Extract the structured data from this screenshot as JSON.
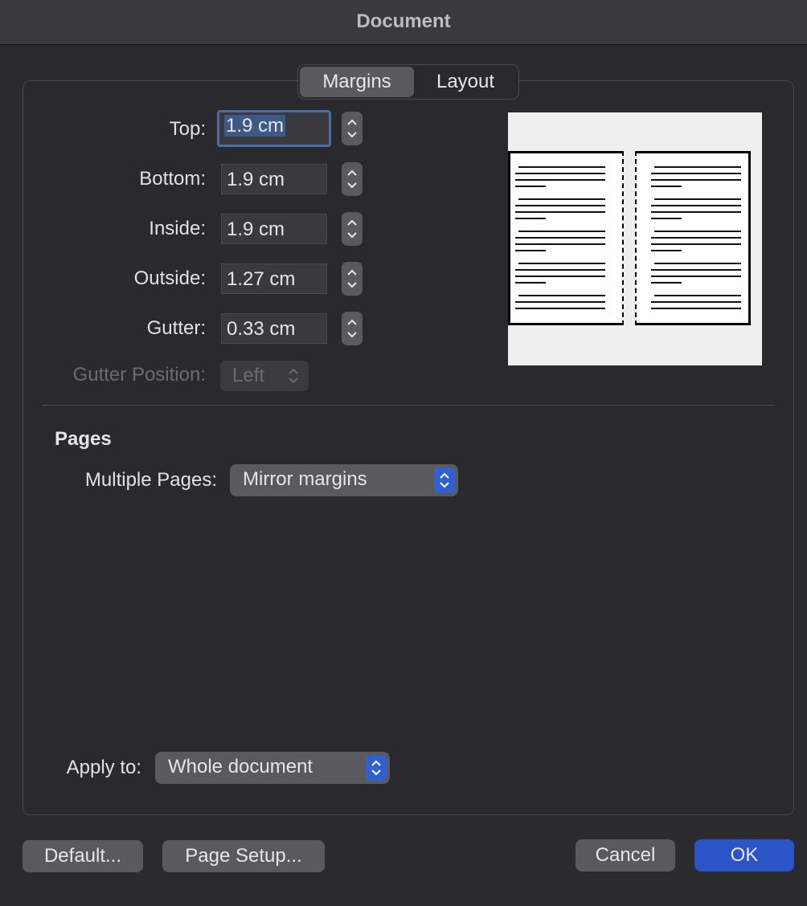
{
  "window": {
    "title": "Document"
  },
  "tabs": [
    {
      "label": "Margins",
      "active": true
    },
    {
      "label": "Layout",
      "active": false
    }
  ],
  "margins": {
    "top": {
      "label": "Top:",
      "value": "1.9 cm"
    },
    "bottom": {
      "label": "Bottom:",
      "value": "1.9 cm"
    },
    "inside": {
      "label": "Inside:",
      "value": "1.9 cm"
    },
    "outside": {
      "label": "Outside:",
      "value": "1.27 cm"
    },
    "gutter": {
      "label": "Gutter:",
      "value": "0.33 cm"
    },
    "gutter_position": {
      "label": "Gutter Position:",
      "value": "Left",
      "enabled": false
    }
  },
  "pages": {
    "section_title": "Pages",
    "multiple_pages": {
      "label": "Multiple Pages:",
      "value": "Mirror margins"
    }
  },
  "apply_to": {
    "label": "Apply to:",
    "value": "Whole document"
  },
  "buttons": {
    "default": "Default...",
    "page_setup": "Page Setup...",
    "cancel": "Cancel",
    "ok": "OK"
  },
  "colors": {
    "accent": "#2b55c6",
    "focus_ring": "#4a6ea3",
    "background": "#2b2a2e"
  }
}
